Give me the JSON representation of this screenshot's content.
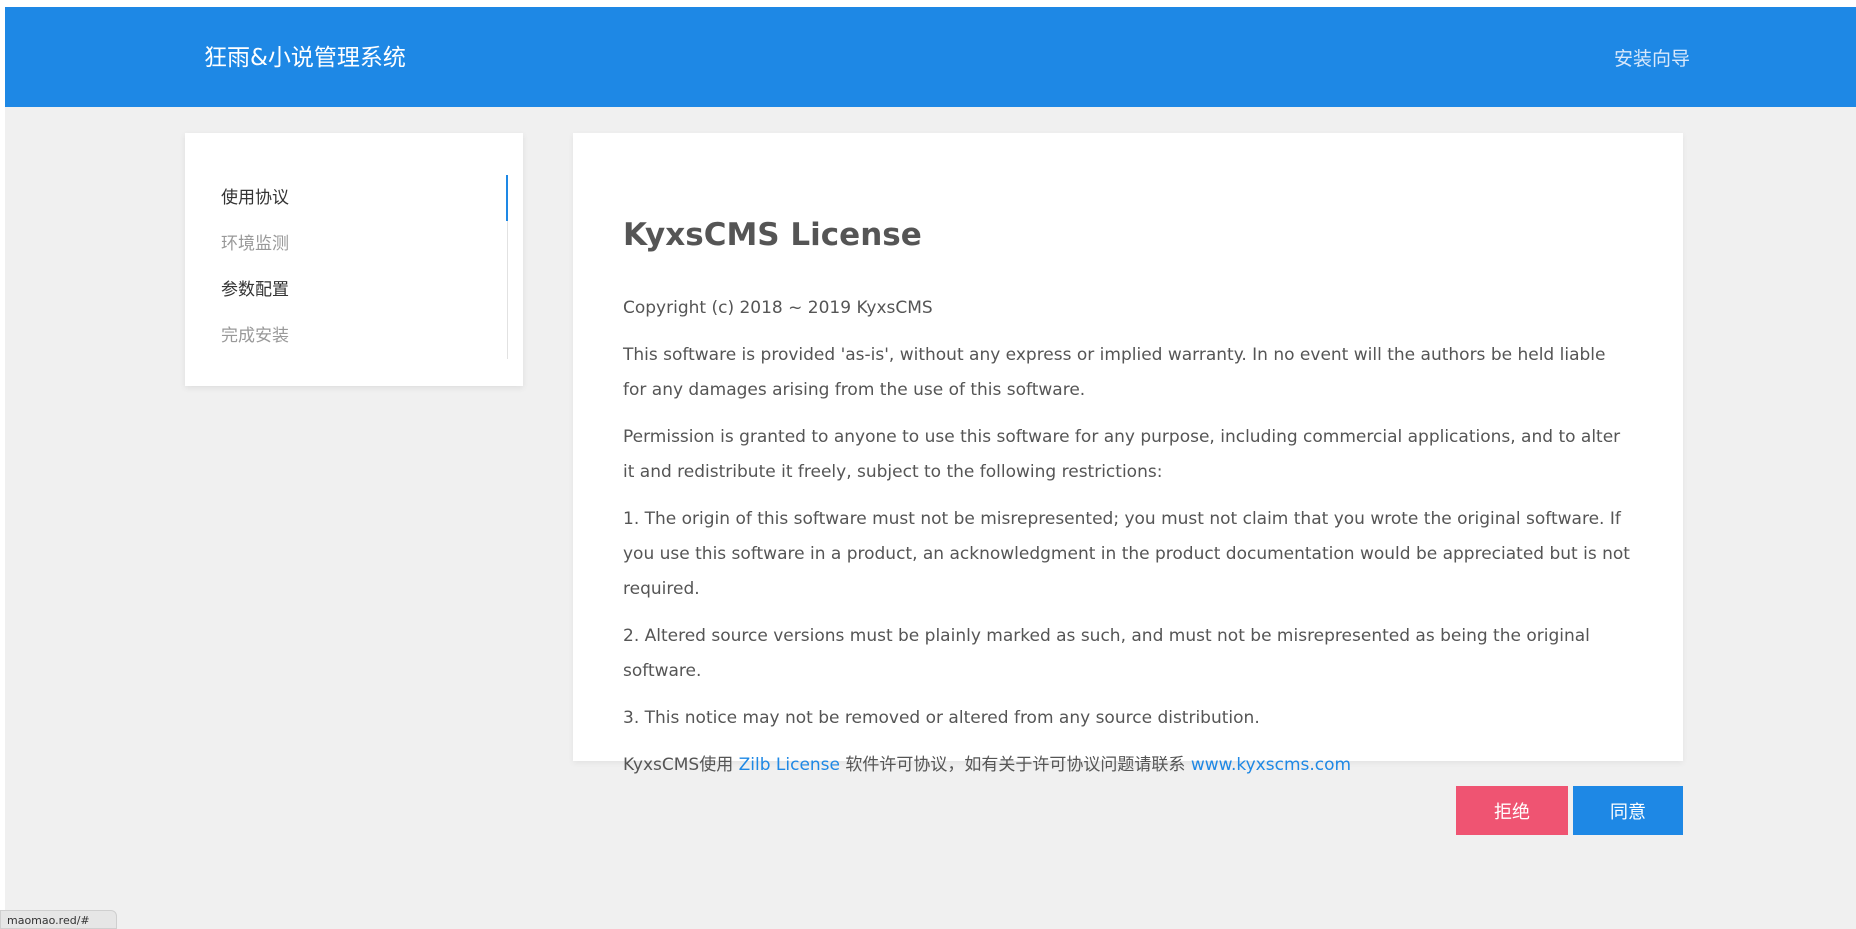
{
  "header": {
    "brand": "狂雨&小说管理系统",
    "install_guide": "安装向导"
  },
  "steps": [
    {
      "label": "使用协议",
      "state": "active"
    },
    {
      "label": "环境监测",
      "state": "pending"
    },
    {
      "label": "参数配置",
      "state": "done"
    },
    {
      "label": "完成安装",
      "state": "pending"
    }
  ],
  "license": {
    "title": "KyxsCMS License",
    "copyright": "Copyright (c) 2018 ~ 2019 KyxsCMS",
    "p1": "This software is provided 'as-is', without any express or implied warranty. In no event will the authors be held liable for any damages arising from the use of this software.",
    "p2": "Permission is granted to anyone to use this software for any purpose, including commercial applications, and to alter it and redistribute it freely, subject to the following restrictions:",
    "r1": "1. The origin of this software must not be misrepresented; you must not claim that you wrote the original software. If you use this software in a product, an acknowledgment in the product documentation would be appreciated but is not required.",
    "r2": "2. Altered source versions must be plainly marked as such, and must not be misrepresented as being the original software.",
    "r3": "3. This notice may not be removed or altered from any source distribution.",
    "footer_prefix": "KyxsCMS使用 ",
    "footer_link1": "Zilb License",
    "footer_middle": " 软件许可协议，如有关于许可协议问题请联系 ",
    "footer_link2": "www.kyxscms.com"
  },
  "actions": {
    "reject": "拒绝",
    "agree": "同意"
  },
  "status_bar": {
    "text": "maomao.red/#"
  },
  "colors": {
    "primary": "#1e88e5",
    "danger": "#ef5472",
    "background": "#f0f0f0"
  }
}
